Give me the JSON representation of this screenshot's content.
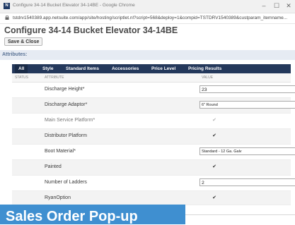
{
  "window": {
    "title": "Configure 34-14 Bucket Elevator 34-14BE - Google Chrome",
    "app_icon": "N",
    "controls": {
      "minimize": "–",
      "maximize": "☐",
      "close": "✕"
    }
  },
  "address": {
    "url": "tstdrv1540389.app.netsuite.com/app/site/hosting/scriptlet.nl?script=568&deploy=1&compid=TSTDRV1540389&custparam_itemname..."
  },
  "page": {
    "title": "Configure 34-14 Bucket Elevator 34-14BE",
    "save_label": "Save & Close",
    "section": "Attributes:"
  },
  "tabs": [
    "All",
    "Style",
    "Standard Items",
    "Accessories",
    "Price Level",
    "Pricing Results"
  ],
  "columns": {
    "status": "STATUS",
    "attribute": "ATTRIBUTE",
    "value": "VALUE"
  },
  "rows": [
    {
      "label": "Discharge Height*",
      "type": "text",
      "value": "23"
    },
    {
      "label": "Discharge Adaptor*",
      "type": "select",
      "value": "6\" Round"
    },
    {
      "label": "Main Service Platform*",
      "type": "checkbox",
      "checked": true,
      "disabled": true
    },
    {
      "label": "Distributor Platform",
      "type": "checkbox",
      "checked": true
    },
    {
      "label": "Boot Material*",
      "type": "select",
      "value": "Standard - 12 Ga. Galv"
    },
    {
      "label": "Painted",
      "type": "checkbox",
      "checked": true
    },
    {
      "label": "Number of Ladders",
      "type": "text",
      "value": "2"
    },
    {
      "label": "RyanOption",
      "type": "checkbox",
      "checked": true
    }
  ],
  "banner": {
    "text": "Sales Order Pop-up"
  },
  "colors": {
    "tabbar": "#24385b",
    "section_header": "#e6ebf3",
    "banner": "#3f8fd0"
  }
}
